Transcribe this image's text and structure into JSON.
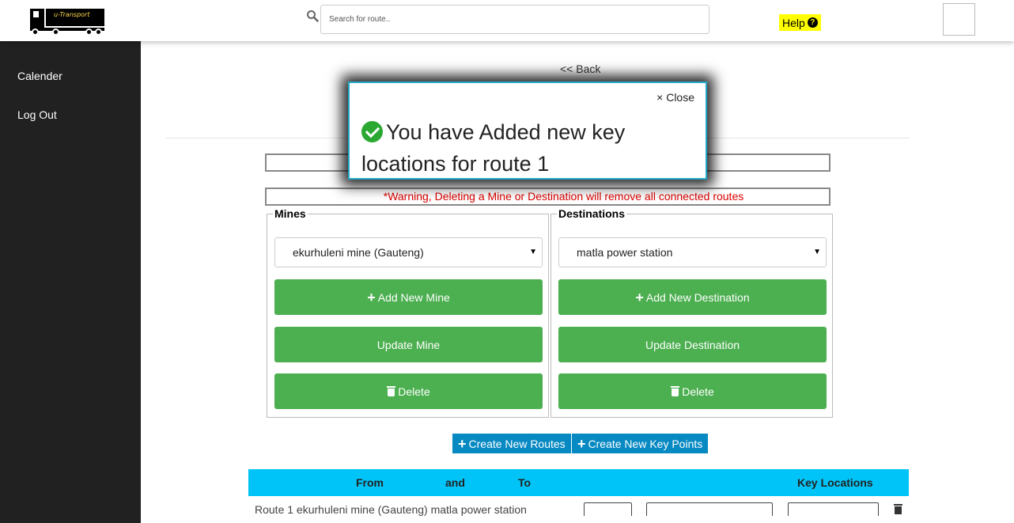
{
  "header": {
    "logo_text": "u-Transport",
    "search_placeholder": "Search for route..",
    "help_label": "Help"
  },
  "sidebar": {
    "items": [
      {
        "label": "Calender"
      },
      {
        "label": "Log Out"
      }
    ]
  },
  "main": {
    "back_label": "<< Back",
    "warning": "*Warning, Deleting a Mine or Destination will remove all connected routes",
    "mines": {
      "legend": "Mines",
      "selected": "ekurhuleni mine (Gauteng)",
      "add_label": "Add New Mine",
      "update_label": "Update Mine",
      "delete_label": "Delete"
    },
    "destinations": {
      "legend": "Destinations",
      "selected": "matla power station",
      "add_label": "Add New Destination",
      "update_label": "Update Destination",
      "delete_label": "Delete"
    },
    "create_routes_label": "Create New Routes",
    "create_keypoints_label": "Create New Key Points",
    "table": {
      "headers": [
        "From",
        "and",
        "To",
        "Key Locations"
      ],
      "row_text": "Route 1  ekurhuleni mine (Gauteng)   matla power station"
    }
  },
  "modal": {
    "close_label": "× Close",
    "message": "You have Added new key locations for route 1"
  },
  "colors": {
    "accent_green": "#4caf50",
    "accent_blue": "#0789c2",
    "table_header": "#00c4f7",
    "sidebar": "#212121",
    "help_bg": "#ffff00",
    "warning_text": "#dd0000"
  }
}
